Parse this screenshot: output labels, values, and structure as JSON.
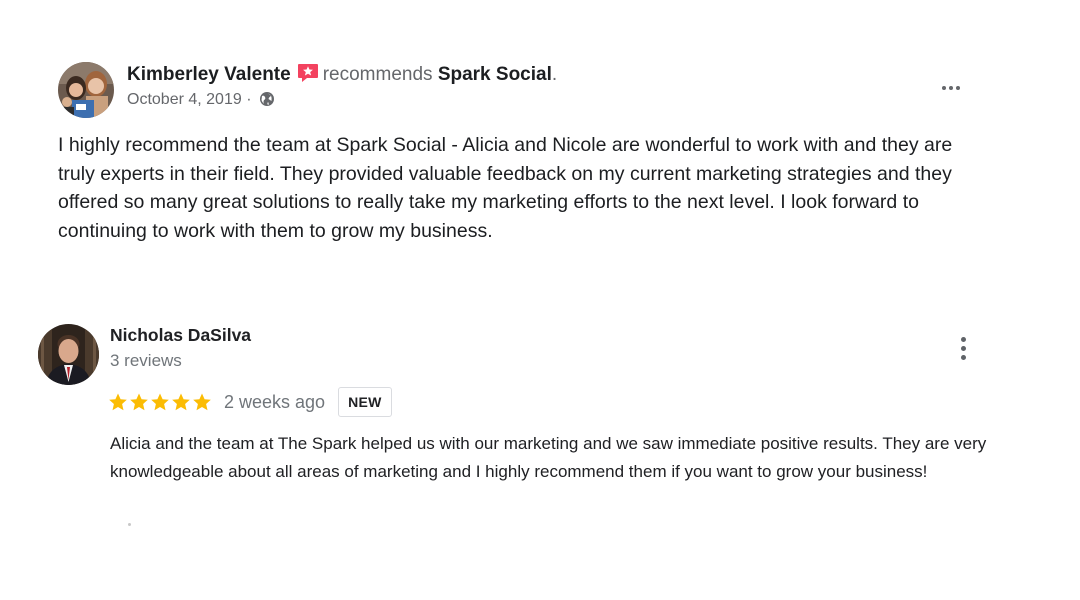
{
  "review1": {
    "reviewer_name": "Kimberley Valente",
    "action_text": "recommends",
    "page_name": "Spark Social",
    "period": ".",
    "date": "October 4, 2019 ·",
    "audience_icon": "globe-icon",
    "recommend_icon": "recommend-star-icon",
    "body": "I highly recommend the team at Spark Social - Alicia and Nicole are wonderful to work with and they are truly experts in their field. They provided valuable feedback on my current marketing strategies and they offered so many great solutions to really take my marketing efforts to the next level. I look forward to continuing to work with them to grow my business.",
    "colors": {
      "recommend_badge": "#f3425f",
      "meta_text": "#65676b"
    }
  },
  "review2": {
    "reviewer_name": "Nicholas DaSilva",
    "review_count": "3 reviews",
    "rating": 5,
    "rating_max": 5,
    "time": "2 weeks ago",
    "badge": "NEW",
    "body": "Alicia and the team at The Spark helped us with our marketing and we saw immediate positive results. They are very knowledgeable about all areas of marketing and I highly recommend them if you want to grow your business!",
    "colors": {
      "star": "#fbbc04",
      "meta_text": "#70757a"
    }
  }
}
